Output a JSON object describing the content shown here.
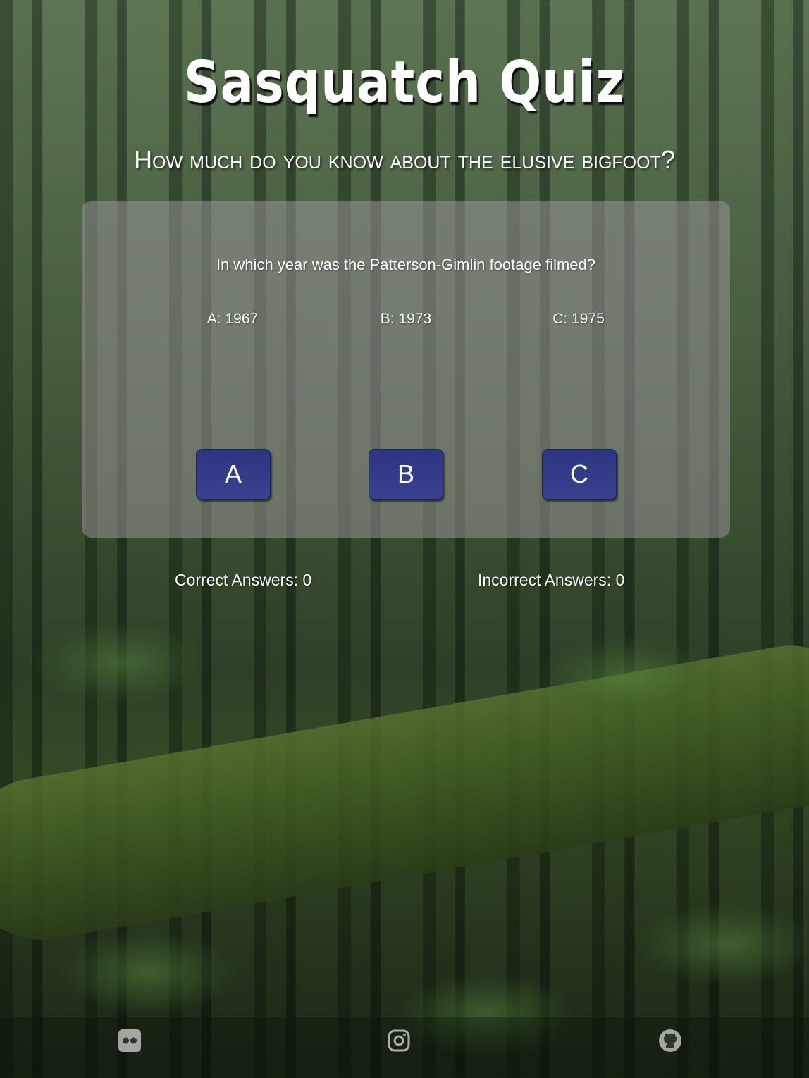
{
  "header": {
    "title": "Sasquatch Quiz",
    "subtitle": "How much do you know about the elusive bigfoot?"
  },
  "quiz": {
    "question": "In which year was the Patterson-Gimlin footage filmed?",
    "options": [
      {
        "text": "A: 1967"
      },
      {
        "text": "B: 1973"
      },
      {
        "text": "C: 1975"
      }
    ],
    "buttons": [
      {
        "label": "A"
      },
      {
        "label": "B"
      },
      {
        "label": "C"
      }
    ]
  },
  "score": {
    "correct": "Correct Answers: 0",
    "incorrect": "Incorrect Answers: 0"
  },
  "footer": {
    "icons": [
      "flickr-icon",
      "instagram-icon",
      "github-icon"
    ]
  },
  "colors": {
    "button_bg": "#2d3582",
    "panel_bg": "rgba(150,150,150,0.55)"
  }
}
